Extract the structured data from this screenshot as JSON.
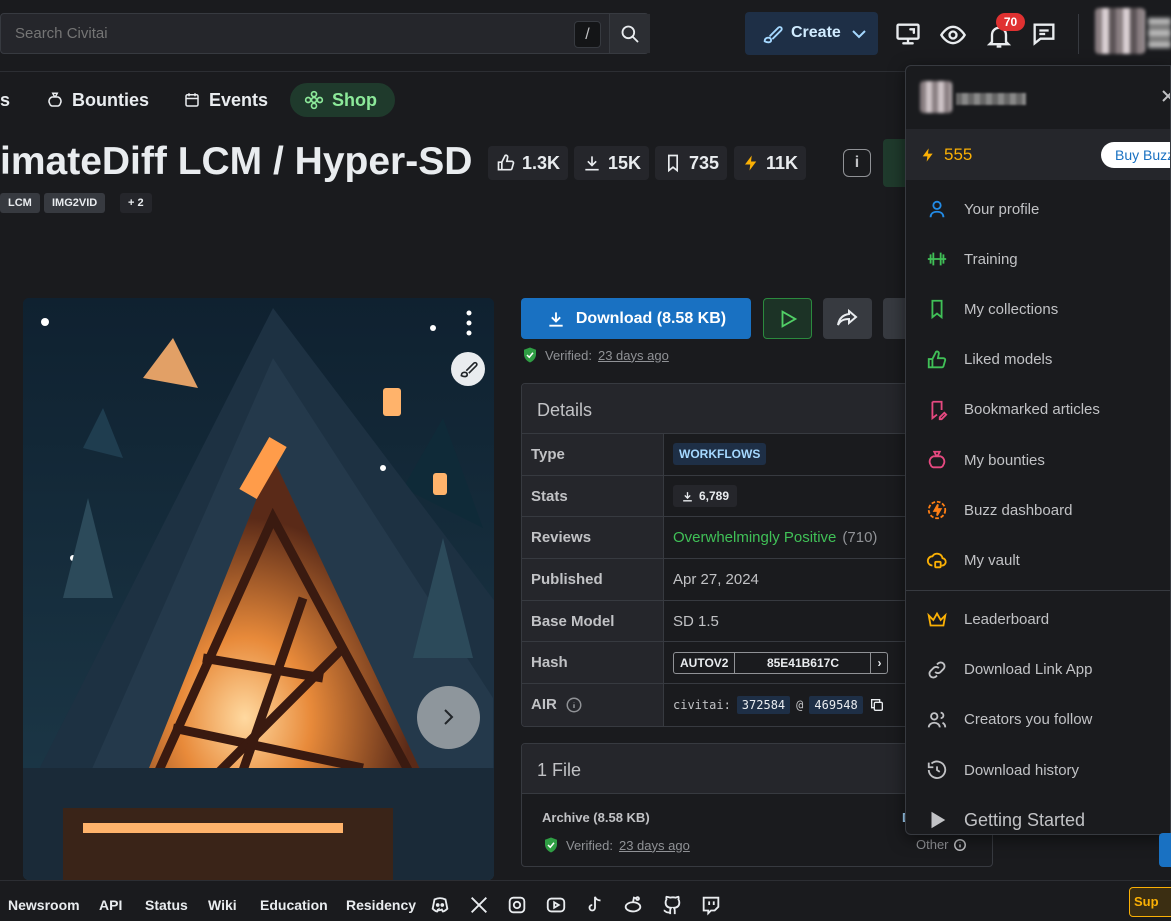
{
  "search": {
    "placeholder": "Search Civitai",
    "shortcut": "/"
  },
  "header": {
    "create_label": "Create",
    "notification_count": "70"
  },
  "nav": {
    "items": [
      {
        "label": "s"
      },
      {
        "label": "Bounties"
      },
      {
        "label": "Events"
      },
      {
        "label": "Shop"
      }
    ]
  },
  "model": {
    "title": "imateDiff LCM / Hyper-SD",
    "stats": {
      "likes": "1.3K",
      "downloads": "15K",
      "collections": "735",
      "buzz": "11K"
    },
    "tags": [
      "LCM",
      "IMG2VID",
      "+ 2"
    ]
  },
  "download": {
    "button_label": "Download (8.58 KB)",
    "verified_label": "Verified:",
    "verified_when": "23 days ago"
  },
  "details": {
    "heading": "Details",
    "rows": {
      "type": {
        "label": "Type",
        "value": "WORKFLOWS"
      },
      "stats": {
        "label": "Stats",
        "value": "6,789"
      },
      "reviews": {
        "label": "Reviews",
        "value": "Overwhelmingly Positive",
        "count": "(710)"
      },
      "published": {
        "label": "Published",
        "value": "Apr 27, 2024"
      },
      "base_model": {
        "label": "Base Model",
        "value": "SD 1.5"
      },
      "hash": {
        "label": "Hash",
        "algo": "AUTOV2",
        "value": "85E41B617C"
      },
      "air": {
        "label": "AIR",
        "prefix": "civitai:",
        "model_id": "372584",
        "at": "@",
        "version_id": "469548"
      }
    }
  },
  "files": {
    "heading": "1 File",
    "file_name": "Archive (8.58 KB)",
    "verified_label": "Verified:",
    "verified_when": "23 days ago",
    "other_label": "Other",
    "cut_label": "D"
  },
  "menu": {
    "buzz_amount": "555",
    "buy_buzz": "Buy Buzz",
    "items": [
      {
        "label": "Your profile",
        "icon": "user-icon",
        "color": "#228be6"
      },
      {
        "label": "Training",
        "icon": "barbell-icon",
        "color": "#40c057"
      },
      {
        "label": "My collections",
        "icon": "bookmark-icon",
        "color": "#40c057"
      },
      {
        "label": "Liked models",
        "icon": "thumb-up-icon",
        "color": "#40c057"
      },
      {
        "label": "Bookmarked articles",
        "icon": "bookmark-edit-icon",
        "color": "#e64980"
      },
      {
        "label": "My bounties",
        "icon": "moneybag-icon",
        "color": "#e64980"
      },
      {
        "label": "Buzz dashboard",
        "icon": "bolt-circle-icon",
        "color": "#fd7e14"
      },
      {
        "label": "My vault",
        "icon": "cloud-lock-icon",
        "color": "#fab005"
      },
      {
        "label": "Leaderboard",
        "icon": "crown-icon",
        "color": "#fab005"
      },
      {
        "label": "Download Link App",
        "icon": "link-icon",
        "color": "#c1c2c5"
      },
      {
        "label": "Creators you follow",
        "icon": "users-icon",
        "color": "#c1c2c5"
      },
      {
        "label": "Download history",
        "icon": "history-icon",
        "color": "#c1c2c5"
      },
      {
        "label": "Getting Started",
        "icon": "play-icon",
        "color": "#c1c2c5"
      }
    ]
  },
  "footer": {
    "links": [
      "Newsroom",
      "API",
      "Status",
      "Wiki",
      "Education",
      "Residency"
    ],
    "support_label": "Sup"
  }
}
